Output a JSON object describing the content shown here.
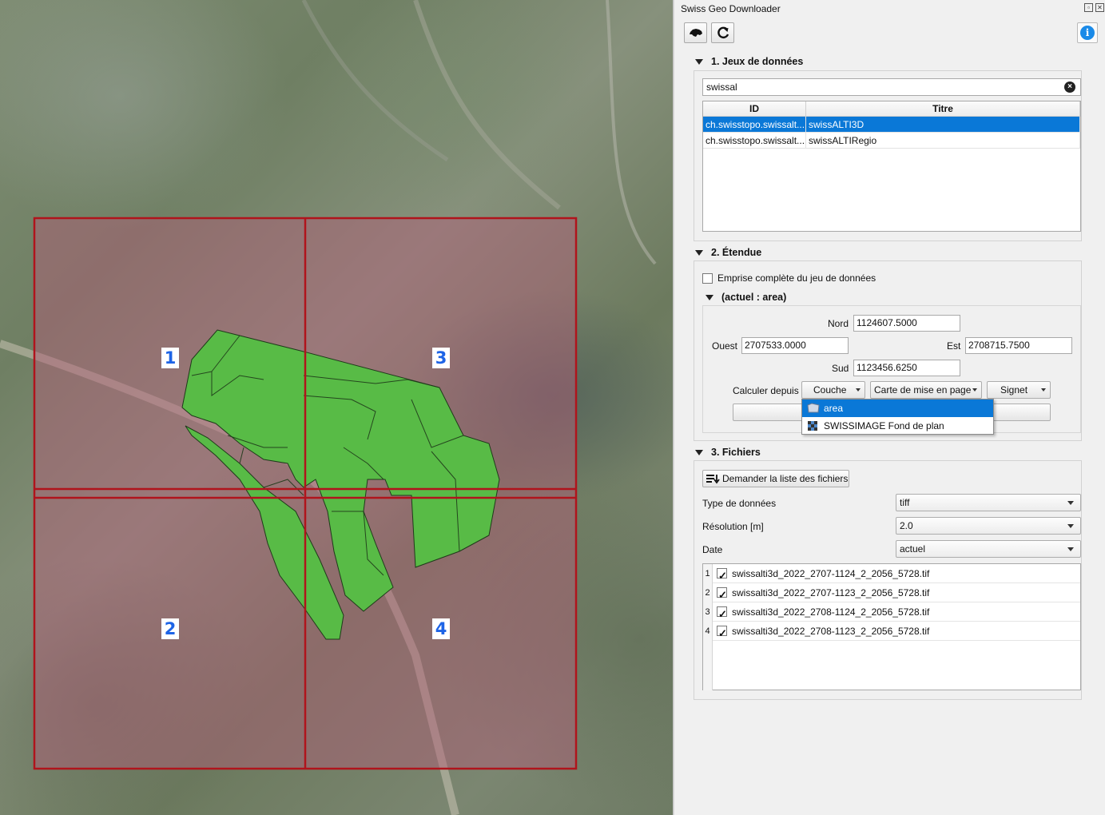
{
  "map": {
    "tile_labels": [
      "1",
      "2",
      "3",
      "4"
    ],
    "colors": {
      "grid_line": "#b0141c",
      "tile_fill": "#b45a78",
      "area_fill": "#58bb46"
    }
  },
  "panel": {
    "title": "Swiss Geo Downloader",
    "toolbar": {
      "swiss_icon": "switzerland-map-icon",
      "refresh_icon": "refresh-icon",
      "info_icon": "info-icon"
    },
    "datasets": {
      "header": "1. Jeux de données",
      "search_value": "swissal",
      "columns": [
        "ID",
        "Titre"
      ],
      "rows": [
        {
          "id": "ch.swisstopo.swissalt...",
          "title": "swissALTI3D",
          "selected": true
        },
        {
          "id": "ch.swisstopo.swissalt...",
          "title": "swissALTIRegio",
          "selected": false
        }
      ]
    },
    "extent": {
      "header": "2. Étendue",
      "full_extent_label": "Emprise complète du jeu de données",
      "sub_header": "(actuel : area)",
      "nord_label": "Nord",
      "nord_value": "1124607.5000",
      "ouest_label": "Ouest",
      "ouest_value": "2707533.0000",
      "est_label": "Est",
      "est_value": "2708715.7500",
      "sud_label": "Sud",
      "sud_value": "1123456.6250",
      "calc_label": "Calculer depuis",
      "btn_couche": "Couche",
      "btn_carte": "Carte de mise en page",
      "btn_signet": "Signet",
      "popup_items": [
        "area",
        "SWISSIMAGE Fond de plan"
      ]
    },
    "files": {
      "header": "3. Fichiers",
      "request_button": "Demander la liste des fichiers",
      "type_label": "Type de données",
      "type_value": "tiff",
      "res_label": "Résolution [m]",
      "res_value": "2.0",
      "date_label": "Date",
      "date_value": "actuel",
      "list": [
        {
          "num": "1",
          "name": "swissalti3d_2022_2707-1124_2_2056_5728.tif",
          "checked": true
        },
        {
          "num": "2",
          "name": "swissalti3d_2022_2707-1123_2_2056_5728.tif",
          "checked": true
        },
        {
          "num": "3",
          "name": "swissalti3d_2022_2708-1124_2_2056_5728.tif",
          "checked": true
        },
        {
          "num": "4",
          "name": "swissalti3d_2022_2708-1123_2_2056_5728.tif",
          "checked": true
        }
      ]
    }
  }
}
